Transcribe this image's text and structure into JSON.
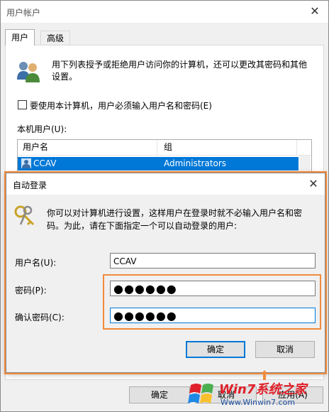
{
  "window": {
    "title": "用户帐户",
    "close_glyph": "✕",
    "tabs": [
      {
        "label": "用户",
        "active": true
      },
      {
        "label": "高级",
        "active": false
      }
    ],
    "description": [
      "用下列表授予或拒绝用户访问你的计算机，还可以更改其密码和其他",
      "设置。"
    ],
    "checkbox_label": "要使用本计算机，用户必须输入用户名和密码(E)",
    "checkbox_checked": false,
    "users_label": "本机用户(U):",
    "table": {
      "columns": [
        "用户名",
        "组"
      ],
      "rows": [
        {
          "username": "CCAV",
          "group": "Administrators",
          "selected": true
        }
      ]
    },
    "buttons": {
      "ok": "确定",
      "cancel": "取消",
      "apply": "应用(A)"
    }
  },
  "dialog": {
    "title": "自动登录",
    "close_glyph": "✕",
    "description": [
      "你可以对计算机进行设置，这样用户在登录时就不必输入用户名和密",
      "码。为此，请在下面指定一个可以自动登录的用户:"
    ],
    "fields": {
      "username_label": "用户名(U):",
      "username_value": "CCAV",
      "password_label": "密码(P):",
      "password_value": "●●●●●●",
      "confirm_label": "确认密码(C):",
      "confirm_value": "●●●●●●"
    },
    "buttons": {
      "ok": "确定",
      "cancel": "取消"
    }
  },
  "watermark": {
    "brand": "Win7系统之家",
    "url": "Www.Winwin7.com"
  },
  "colors": {
    "selection": "#0078d7",
    "highlight_border": "#f08b3c",
    "watermark_red": "#e0202a"
  }
}
